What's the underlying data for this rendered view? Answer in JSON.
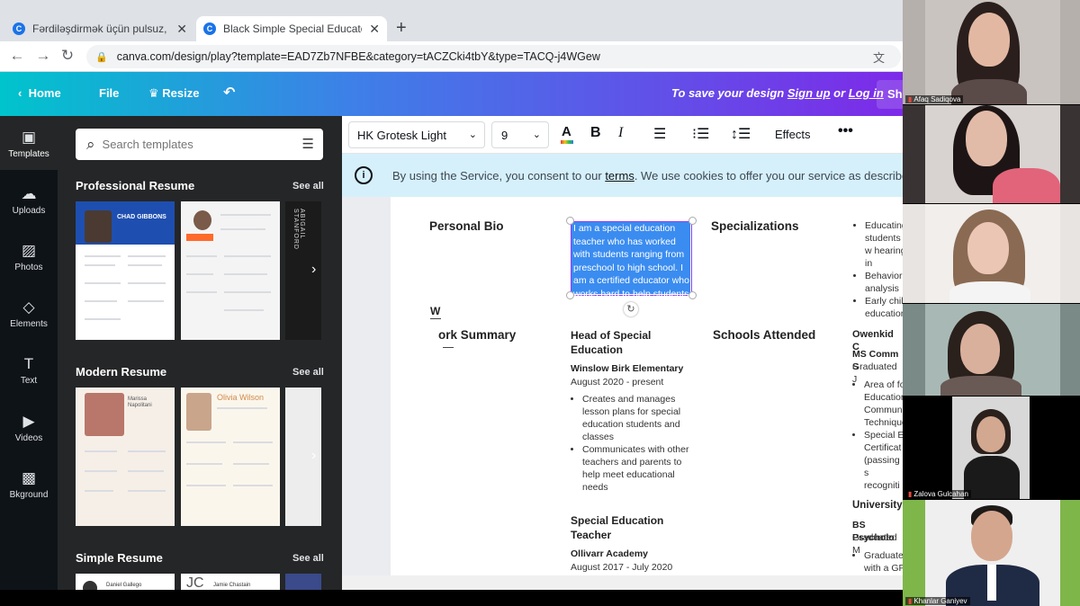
{
  "browser": {
    "tabs": [
      {
        "favicon": "C",
        "title": "Fərdiləşdirmək üçün pulsuz, peşə"
      },
      {
        "favicon": "C",
        "title": "Black Simple Special Educator Re"
      }
    ],
    "url": "canva.com/design/play?template=EAD7Zb7NFBE&category=tACZCki4tbY&type=TACQ-j4WGew"
  },
  "canva_header": {
    "home": "Home",
    "file": "File",
    "resize": "Resize",
    "save_prefix": "To save your design",
    "signup": "Sign up",
    "or": "or",
    "login": "Log in",
    "share": "Sha"
  },
  "rail": [
    {
      "label": "Templates",
      "icon": "templates-icon"
    },
    {
      "label": "Uploads",
      "icon": "uploads-icon"
    },
    {
      "label": "Photos",
      "icon": "photos-icon"
    },
    {
      "label": "Elements",
      "icon": "elements-icon"
    },
    {
      "label": "Text",
      "icon": "text-icon"
    },
    {
      "label": "Videos",
      "icon": "videos-icon"
    },
    {
      "label": "Bkground",
      "icon": "background-icon"
    }
  ],
  "panel": {
    "search_placeholder": "Search templates",
    "see_all": "See all",
    "sections": [
      {
        "title": "Professional Resume",
        "thumb1_name": "CHAD GIBBONS",
        "thumb3_name": "ABIGAIL STANFORD"
      },
      {
        "title": "Modern Resume",
        "thumb1_name": "Marissa Napolitani",
        "thumb2_name": "Olivia Wilson"
      },
      {
        "title": "Simple Resume",
        "thumb1_name": "Daniel Gallego",
        "thumb2_name": "Jamie Chastain",
        "thumb2_mono": "JC"
      }
    ]
  },
  "toolbar": {
    "font": "HK Grotesk Light",
    "size": "9",
    "effects": "Effects"
  },
  "cookie": {
    "before": "By using the Service, you consent to our",
    "link": "terms",
    "after": ". We use cookies to offer you our service as described"
  },
  "resume": {
    "personal_bio": "Personal Bio",
    "bio_text": "I am a special education teacher who has worked with students ranging from preschool to high school. I am a certified educator who works hard to help students.",
    "specializations": "Specializations",
    "spec_items": [
      "Educating students w hearing in",
      "Behavioral analysis",
      "Early chil education"
    ],
    "work_summary": "ork Summary",
    "work_w": "W",
    "job1_title": "Head of Special Education",
    "job1_org": "Winslow Birk Elementary",
    "job1_dates": "August 2020 - present",
    "job1_items": [
      "Creates and manages lesson plans for special education students and classes",
      "Communicates with other teachers and parents to help meet educational needs"
    ],
    "job2_title": "Special Education Teacher",
    "job2_org": "Ollivarr Academy",
    "job2_dates": "August 2017 - July 2020",
    "schools_attended": "Schools Attended",
    "school1": "Owenkid C",
    "school1_degree": "MS Comm S",
    "school1_grad": "Graduated J",
    "school1_items": [
      "Area of fo Education Communi Technique",
      "Special E Certificat (passing s recogniti"
    ],
    "school2": "University",
    "school2_degree": "BS Psycholo",
    "school2_grad": "Graduated M",
    "school2_items": [
      "Graduate with a GP"
    ]
  },
  "participants": [
    {
      "name": "Afaq Sadiqova"
    },
    {
      "name": ""
    },
    {
      "name": ""
    },
    {
      "name": ""
    },
    {
      "name": "Zalova Gulcahan"
    },
    {
      "name": "Khanlar Ganiyev"
    }
  ]
}
